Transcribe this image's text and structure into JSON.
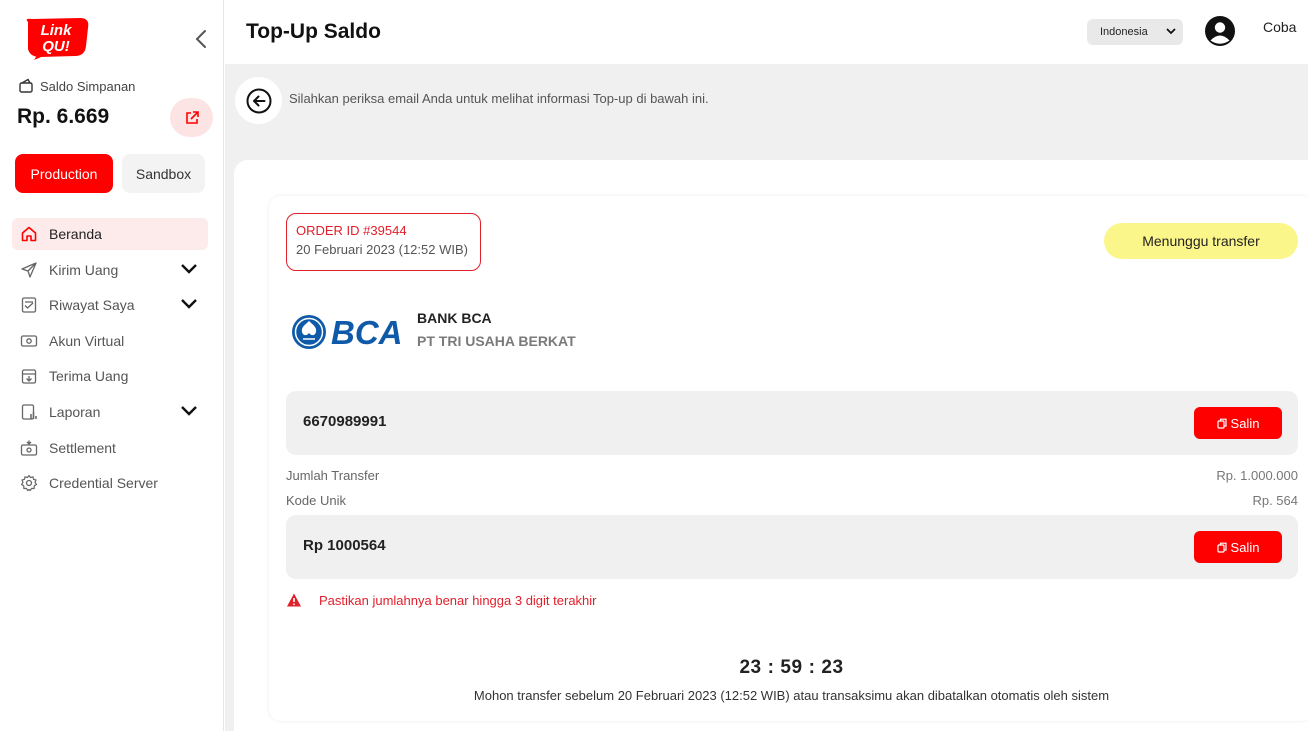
{
  "app": {
    "logo_text": "Link QU!",
    "brand_color": "#ff0000"
  },
  "sidebar": {
    "saldo_label": "Saldo Simpanan",
    "saldo_value": "Rp. 6.669",
    "env_production": "Production",
    "env_sandbox": "Sandbox",
    "items": [
      {
        "label": "Beranda",
        "icon": "home-icon",
        "active": true
      },
      {
        "label": "Kirim Uang",
        "icon": "send-icon",
        "expandable": true
      },
      {
        "label": "Riwayat Saya",
        "icon": "history-icon",
        "expandable": true
      },
      {
        "label": "Akun Virtual",
        "icon": "virtual-account-icon"
      },
      {
        "label": "Terima Uang",
        "icon": "receive-icon"
      },
      {
        "label": "Laporan",
        "icon": "report-icon",
        "expandable": true
      },
      {
        "label": "Settlement",
        "icon": "settlement-icon"
      },
      {
        "label": "Credential Server",
        "icon": "settings-icon"
      }
    ]
  },
  "header": {
    "title": "Top-Up Saldo",
    "language": "Indonesia",
    "user_name": "Coba"
  },
  "main": {
    "info_text": "Silahkan periksa email Anda untuk melihat informasi Top-up di bawah ini.",
    "order_id": "ORDER ID #39544",
    "order_date": "20 Februari 2023 (12:52 WIB)",
    "status": "Menunggu transfer",
    "status_color": "#fbf68a",
    "bank_logo_text": "BCA",
    "bank_name": "BANK BCA",
    "bank_company": "PT TRI USAHA BERKAT",
    "account_number": "6670989991",
    "copy_label": "Salin",
    "jumlah_transfer_label": "Jumlah Transfer",
    "jumlah_transfer_value": "Rp. 1.000.000",
    "kode_unik_label": "Kode Unik",
    "kode_unik_value": "Rp. 564",
    "total_amount": "Rp 1000564",
    "warning_text": "Pastikan jumlahnya benar hingga 3 digit terakhir",
    "timer": {
      "hours": "23",
      "minutes": "59",
      "seconds": "23"
    },
    "deadline_text": "Mohon transfer sebelum 20 Februari 2023 (12:52 WIB) atau transaksimu akan dibatalkan otomatis oleh sistem"
  }
}
